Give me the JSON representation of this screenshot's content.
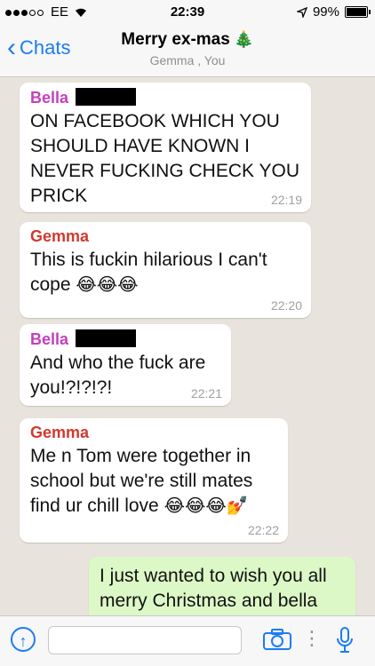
{
  "status_bar": {
    "carrier": "EE",
    "time": "22:39",
    "battery": "99%"
  },
  "header": {
    "back_label": "Chats",
    "title": "Merry ex-mas",
    "title_emoji": "🎄",
    "participants": "Gemma , You"
  },
  "messages": [
    {
      "sender": "Bella",
      "sender_color": "#c43fbe",
      "text": "ON FACEBOOK WHICH YOU SHOULD HAVE KNOWN I NEVER FUCKING CHECK YOU PRICK",
      "time": "22:19"
    },
    {
      "sender": "Gemma",
      "sender_color": "#d03a2e",
      "text": "This is fuckin hilarious I can't cope",
      "emoji": "😂😂😂",
      "time": "22:20"
    },
    {
      "sender": "Bella",
      "sender_color": "#c43fbe",
      "text": "And who the fuck are you!?!?!?!",
      "time": "22:21"
    },
    {
      "sender": "Gemma",
      "sender_color": "#d03a2e",
      "text": "Me n Tom were together in school but we're still mates find ur chill love",
      "emoji": "😂😂😂💅",
      "time": "22:22"
    },
    {
      "text": "I just wanted to wish you all merry Christmas and bella"
    }
  ],
  "input_bar": {
    "icons": [
      "attach-icon",
      "camera-icon",
      "more-icon",
      "microphone-icon"
    ],
    "accent_color": "#1b7cf5"
  }
}
